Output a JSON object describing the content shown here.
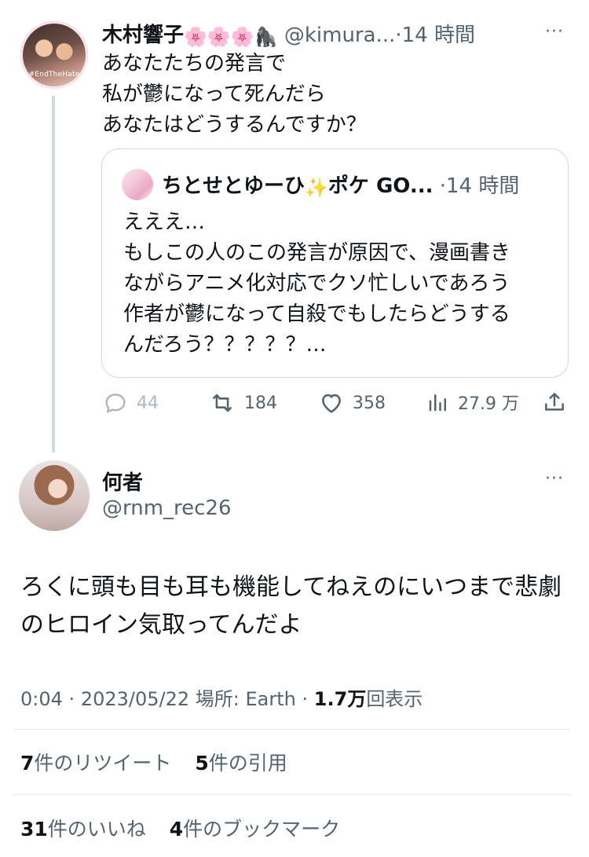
{
  "quoted_tweet": {
    "author_name": "木村響子",
    "name_emojis": [
      "🌸",
      "🌸",
      "🌸",
      "🦍"
    ],
    "avatar_tag": "#EndTheHate",
    "handle": "@kimura...",
    "separator": "·",
    "time": "14 時間",
    "more": "···",
    "text": "あなたたちの発言で\n私が鬱になって死んだら\nあなたはどうするんですか？",
    "embedded": {
      "author_name": "ちとせとゆーひ",
      "name_emoji": "✨",
      "name_suffix": "ポケ GO...",
      "separator": "·",
      "time": "14 時間",
      "text": "えええ…\nもしこの人のこの発言が原因で、漫画書き\nながらアニメ化対応でクソ忙しいであろう\n作者が鬱になって自殺でもしたらどうする\nんだろう？？？？？…"
    },
    "actions": {
      "reply_count": "44",
      "retweet_count": "184",
      "like_count": "358",
      "view_count": "27.9 万"
    }
  },
  "reply_tweet": {
    "author_name": "何者",
    "handle": "@rnm_rec26",
    "more": "···",
    "text": "ろくに頭も目も耳も機能してねえのにいつまで悲劇のヒロイン気取ってんだよ",
    "time": "0:04",
    "dot1": "·",
    "date": "2023/05/22",
    "location": "場所: Earth",
    "dot2": "·",
    "views_value": "1.7万",
    "views_label": "回表示"
  },
  "stats": {
    "retweets_value": "7",
    "retweets_label": "件のリツイート",
    "quotes_value": "5",
    "quotes_label": "件の引用",
    "likes_value": "31",
    "likes_label": "件のいいね",
    "bookmarks_value": "4",
    "bookmarks_label": "件のブックマーク"
  },
  "colors": {
    "text": "#0f1419",
    "muted": "#536471",
    "border": "#cfd9de"
  }
}
